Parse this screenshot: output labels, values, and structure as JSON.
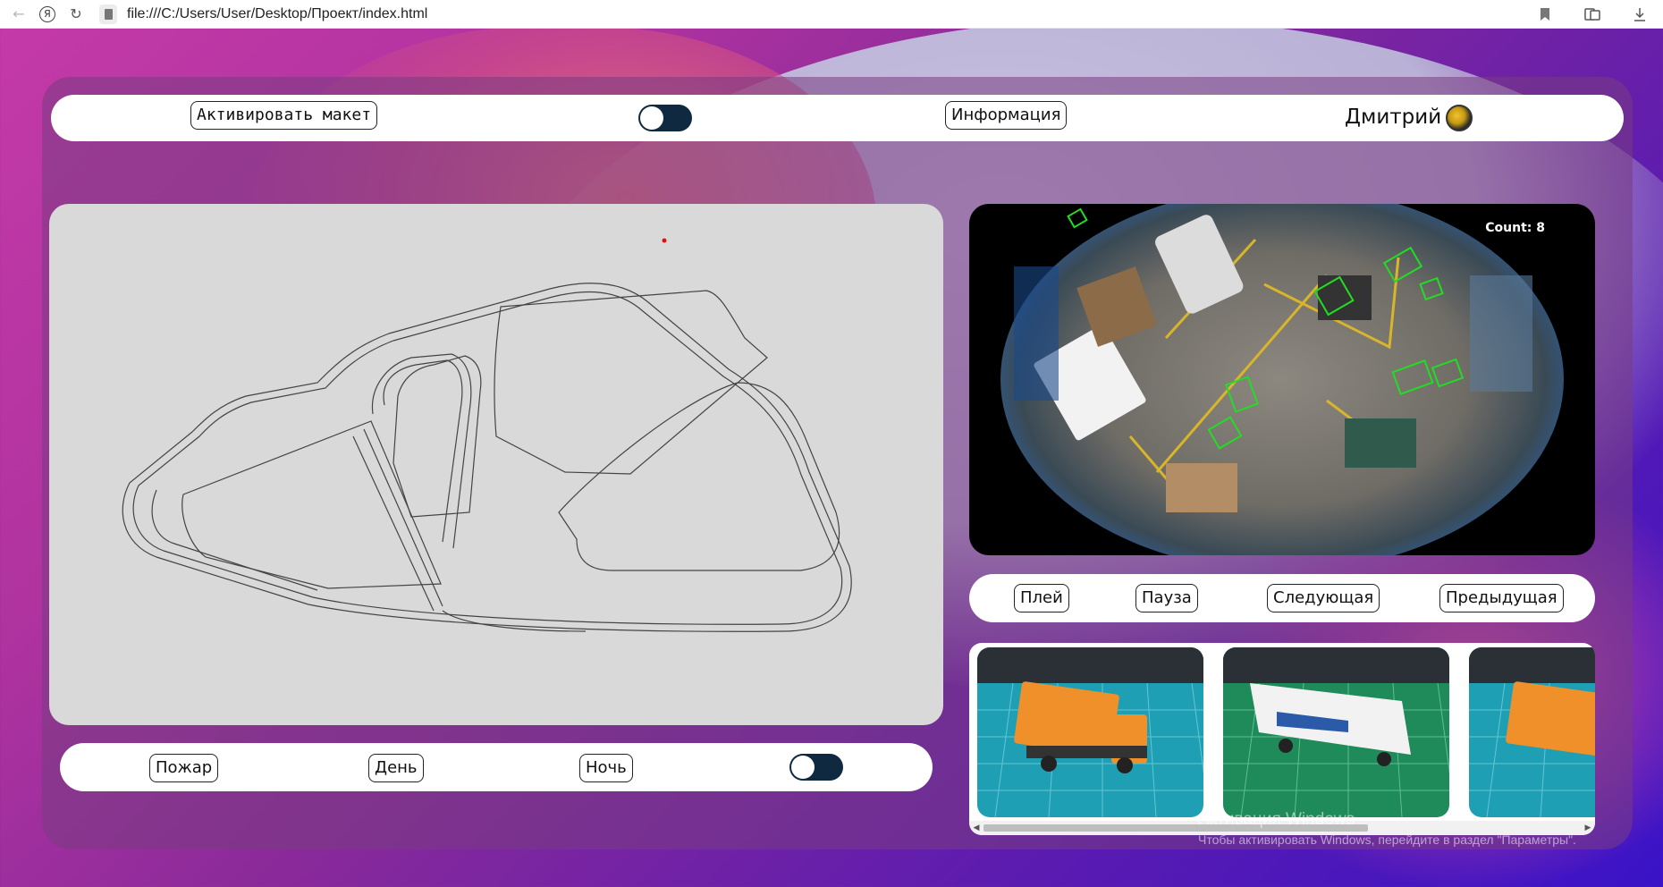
{
  "browser": {
    "url": "file:///C:/Users/User/Desktop/Проект/index.html",
    "yandex_glyph": "Я"
  },
  "topbar": {
    "activate_label": "Активировать макет",
    "info_label": "Информация",
    "user_name": "Дмитрий"
  },
  "camera": {
    "count_text": "Count: 8"
  },
  "controls": {
    "play": "Плей",
    "pause": "Пауза",
    "next": "Следующая",
    "prev": "Предыдущая"
  },
  "bottombar": {
    "fire": "Пожар",
    "day": "День",
    "night": "Ночь"
  },
  "gallery": {
    "thumbnails": [
      "orange-truck-thumbnail",
      "white-bus-thumbnail",
      "orange-truck-thumbnail"
    ]
  },
  "watermark": {
    "line1": "Активация Windows",
    "line2": "Чтобы активировать Windows, перейдите в раздел \"Параметры\"."
  },
  "colors": {
    "toggle_bg": "#0f2a40",
    "map_bg": "#d9d9d9",
    "detection_box": "#22dd22"
  }
}
